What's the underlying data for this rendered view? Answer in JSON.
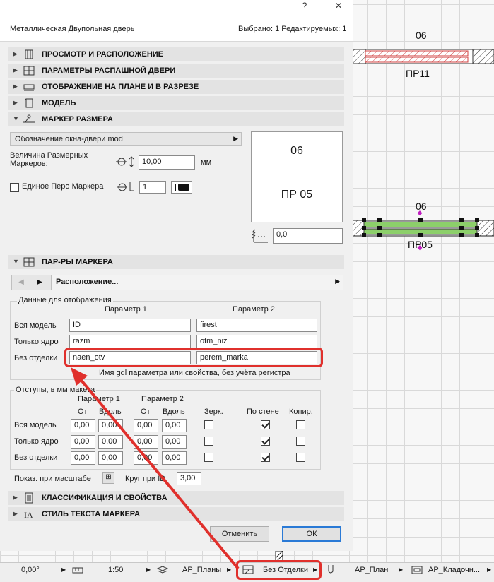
{
  "titlebar": {
    "help": "?",
    "close": "✕"
  },
  "header": {
    "title": "Металлическая Двупольная дверь",
    "selection_info": "Выбрано: 1 Редактируемых: 1"
  },
  "sections": [
    {
      "label": "ПРОСМОТР И РАСПОЛОЖЕНИЕ",
      "icon": "preview-icon"
    },
    {
      "label": "ПАРАМЕТРЫ РАСПАШНОЙ ДВЕРИ",
      "icon": "door-params-icon"
    },
    {
      "label": "ОТОБРАЖЕНИЕ НА ПЛАНЕ И В РАЗРЕЗЕ",
      "icon": "plan-section-icon"
    },
    {
      "label": "МОДЕЛЬ",
      "icon": "model-icon"
    },
    {
      "label": "МАРКЕР РАЗМЕРА",
      "icon": "dimension-marker-icon"
    }
  ],
  "marker_size": {
    "dropdown_value": "Обозначение окна-двери mod",
    "size_label": "Величина Размерных Маркеров:",
    "size_value": "10,00",
    "size_unit": "мм",
    "pen_label": "Единое Перо Маркера",
    "pen_value": "1",
    "preview_top": "06",
    "preview_bottom": "ПР 05",
    "angle_value": "0,0"
  },
  "marker_params": {
    "section_label": "ПАР-РЫ МАРКЕРА",
    "page_label": "Расположение...",
    "display_group": "Данные для отображения",
    "col1": "Параметр 1",
    "col2": "Параметр 2",
    "rows": [
      {
        "label": "Вся модель",
        "p1": "ID",
        "p2": "firest"
      },
      {
        "label": "Только ядро",
        "p1": "razm",
        "p2": "otm_niz"
      },
      {
        "label": "Без отделки",
        "p1": "naen_otv",
        "p2": "perem_marka"
      }
    ],
    "hint": "Имя gdl параметра или свойства, без учёта регистра",
    "offsets_group": "Отступы, в мм макета",
    "off_p1": "Параметр 1",
    "off_p2": "Параметр 2",
    "from": "От",
    "along": "Вдоль",
    "mirror": "Зерк.",
    "by_wall": "По стене",
    "copy": "Копир.",
    "offset_rows": [
      {
        "label": "Вся модель",
        "v1": "0,00",
        "v2": "0,00",
        "v3": "0,00",
        "v4": "0,00",
        "mirror": false,
        "wall": true,
        "copy": false
      },
      {
        "label": "Только ядро",
        "v1": "0,00",
        "v2": "0,00",
        "v3": "0,00",
        "v4": "0,00",
        "mirror": false,
        "wall": true,
        "copy": false
      },
      {
        "label": "Без отделки",
        "v1": "0,00",
        "v2": "0,00",
        "v3": "0,00",
        "v4": "0,00",
        "mirror": false,
        "wall": true,
        "copy": false
      }
    ],
    "show_scale_label": "Показ. при масштабе",
    "circle_label": "Круг при ID",
    "circle_value": "3,00"
  },
  "bottom_sections": [
    {
      "label": "КЛАССИФИКАЦИЯ И СВОЙСТВА",
      "icon": "classification-icon"
    },
    {
      "label": "СТИЛЬ ТЕКСТА МАРКЕРА",
      "icon": "text-style-icon"
    }
  ],
  "buttons": {
    "cancel": "Отменить",
    "ok": "ОК"
  },
  "plan": {
    "top_label": "06",
    "top_id": "ПР11",
    "mid_label": "06",
    "mid_id": "ПР05"
  },
  "statusbar": {
    "angle": "0,00°",
    "scale": "1:50",
    "layer_combo": "АР_Планы",
    "model_view": "Без Отделки",
    "pen_set": "АР_План",
    "graphic_override": "АР_Кладочн..."
  },
  "colors": {
    "highlight": "#e0302c",
    "dialog_bg": "#f0f0f0",
    "section_bg": "#e3e3e3",
    "selection_green": "#7bc043"
  }
}
